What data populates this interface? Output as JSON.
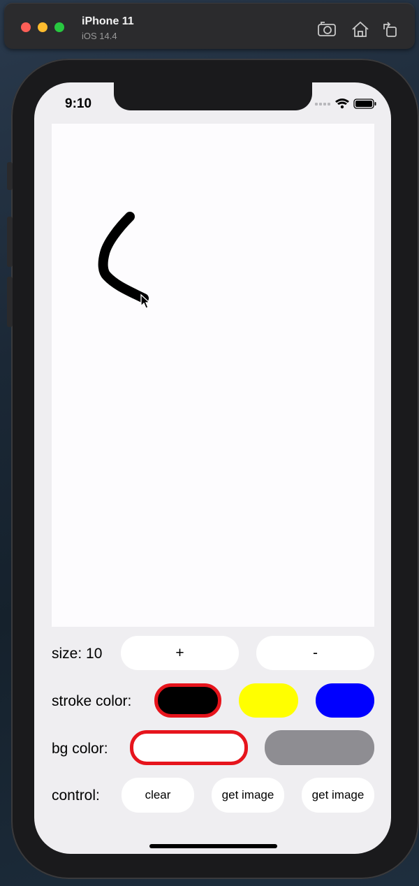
{
  "device": {
    "name": "iPhone 11",
    "os": "iOS 14.4"
  },
  "toolbar": {
    "icons": [
      "screenshot-icon",
      "home-icon",
      "rotate-icon"
    ]
  },
  "status_bar": {
    "time": "9:10",
    "icons": [
      "signal-dots-icon",
      "wifi-icon",
      "battery-icon"
    ]
  },
  "canvas": {
    "stroke_color": "#000000",
    "background": "#fdfcfe"
  },
  "size_row": {
    "label": "size: 10",
    "increase_label": "+",
    "decrease_label": "-"
  },
  "stroke_row": {
    "label": "stroke color:",
    "options": [
      {
        "color": "#000000",
        "selected": true
      },
      {
        "color": "#ffff00",
        "selected": false
      },
      {
        "color": "#0000ff",
        "selected": false
      }
    ]
  },
  "bg_row": {
    "label": "bg color:",
    "options": [
      {
        "color": "#ffffff",
        "selected": true
      },
      {
        "color": "#8e8d92",
        "selected": false
      }
    ]
  },
  "control_row": {
    "label": "control:",
    "buttons": [
      "clear",
      "get image",
      "get image"
    ]
  },
  "colors": {
    "selected_border": "#e6141c",
    "button_bg": "#ffffff"
  }
}
